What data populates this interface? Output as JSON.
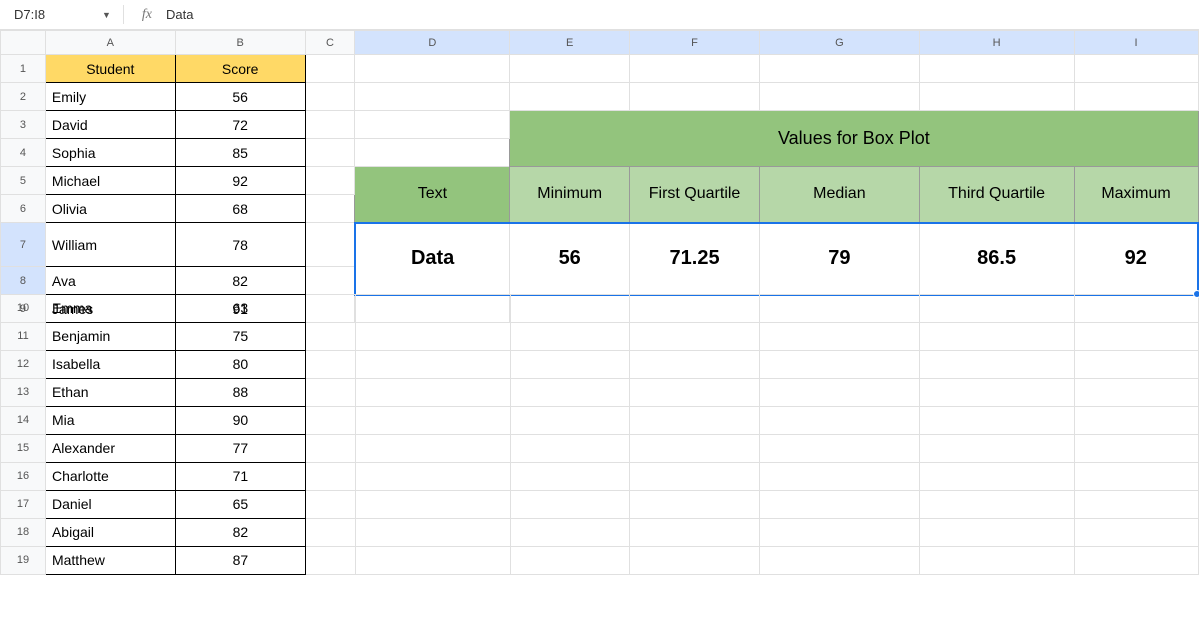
{
  "formula_bar": {
    "name_box": "D7:I8",
    "formula": "Data"
  },
  "columns": [
    "A",
    "B",
    "C",
    "D",
    "E",
    "F",
    "G",
    "H",
    "I"
  ],
  "row_numbers": [
    "1",
    "2",
    "3",
    "4",
    "5",
    "6",
    "7",
    "8",
    "9",
    "10",
    "11",
    "12",
    "13",
    "14",
    "15",
    "16",
    "17",
    "18",
    "19"
  ],
  "headers": {
    "student": "Student",
    "score": "Score"
  },
  "students": [
    {
      "name": "Emily",
      "score": "56"
    },
    {
      "name": "David",
      "score": "72"
    },
    {
      "name": "Sophia",
      "score": "85"
    },
    {
      "name": "Michael",
      "score": "92"
    },
    {
      "name": "Olivia",
      "score": "68"
    },
    {
      "name": "William",
      "score": "78"
    },
    {
      "name": "Ava",
      "score": "82"
    },
    {
      "name": "James",
      "score": "91"
    },
    {
      "name": "Emma",
      "score": "63"
    },
    {
      "name": "Benjamin",
      "score": "75"
    },
    {
      "name": "Isabella",
      "score": "80"
    },
    {
      "name": "Ethan",
      "score": "88"
    },
    {
      "name": "Mia",
      "score": "90"
    },
    {
      "name": "Alexander",
      "score": "77"
    },
    {
      "name": "Charlotte",
      "score": "71"
    },
    {
      "name": "Daniel",
      "score": "65"
    },
    {
      "name": "Abigail",
      "score": "82"
    },
    {
      "name": "Matthew",
      "score": "87"
    }
  ],
  "box": {
    "title": "Values for Box Plot",
    "headers": {
      "text": "Text",
      "minimum": "Minimum",
      "first_q": "First Quartile",
      "median": "Median",
      "third_q": "Third Quartile",
      "maximum": "Maximum"
    },
    "data": {
      "label": "Data",
      "minimum": "56",
      "first_q": "71.25",
      "median": "79",
      "third_q": "86.5",
      "maximum": "92"
    }
  },
  "chart_data": {
    "type": "table",
    "title": "Values for Box Plot",
    "categories": [
      "Minimum",
      "First Quartile",
      "Median",
      "Third Quartile",
      "Maximum"
    ],
    "values": [
      56,
      71.25,
      79,
      86.5,
      92
    ],
    "series_name": "Data"
  }
}
